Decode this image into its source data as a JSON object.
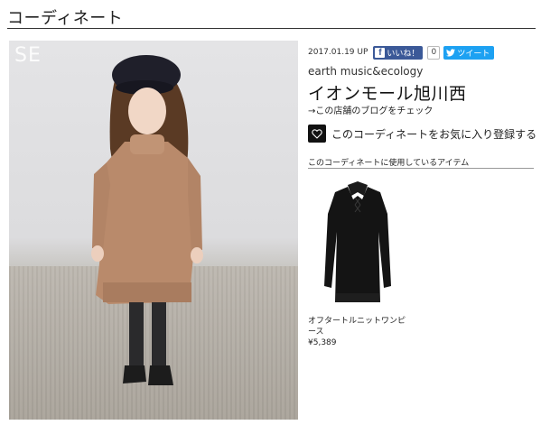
{
  "page": {
    "title": "コーディネート"
  },
  "photo": {
    "watermark": "SE"
  },
  "post": {
    "date": "2017.01.19 UP",
    "share": {
      "facebook_label": "いいね！",
      "facebook_count": "0",
      "twitter_label": "ツイート"
    },
    "brand": "earth music&ecology",
    "shop_name": "イオンモール旭川西",
    "blog_link": "→この店舗のブログをチェック",
    "favorite_label": "このコーディネートをお気に入り登録する"
  },
  "items": {
    "heading": "このコーディネートに使用しているアイテム",
    "list": [
      {
        "name": "オフタートルニットワンピース",
        "price": "¥5,389"
      }
    ]
  },
  "colors": {
    "facebook": "#3b5998",
    "twitter": "#1da1f2",
    "favorite_button": "#111111"
  },
  "icons": {
    "facebook": "facebook-icon",
    "twitter": "twitter-bird-icon",
    "favorite": "heart-icon"
  }
}
